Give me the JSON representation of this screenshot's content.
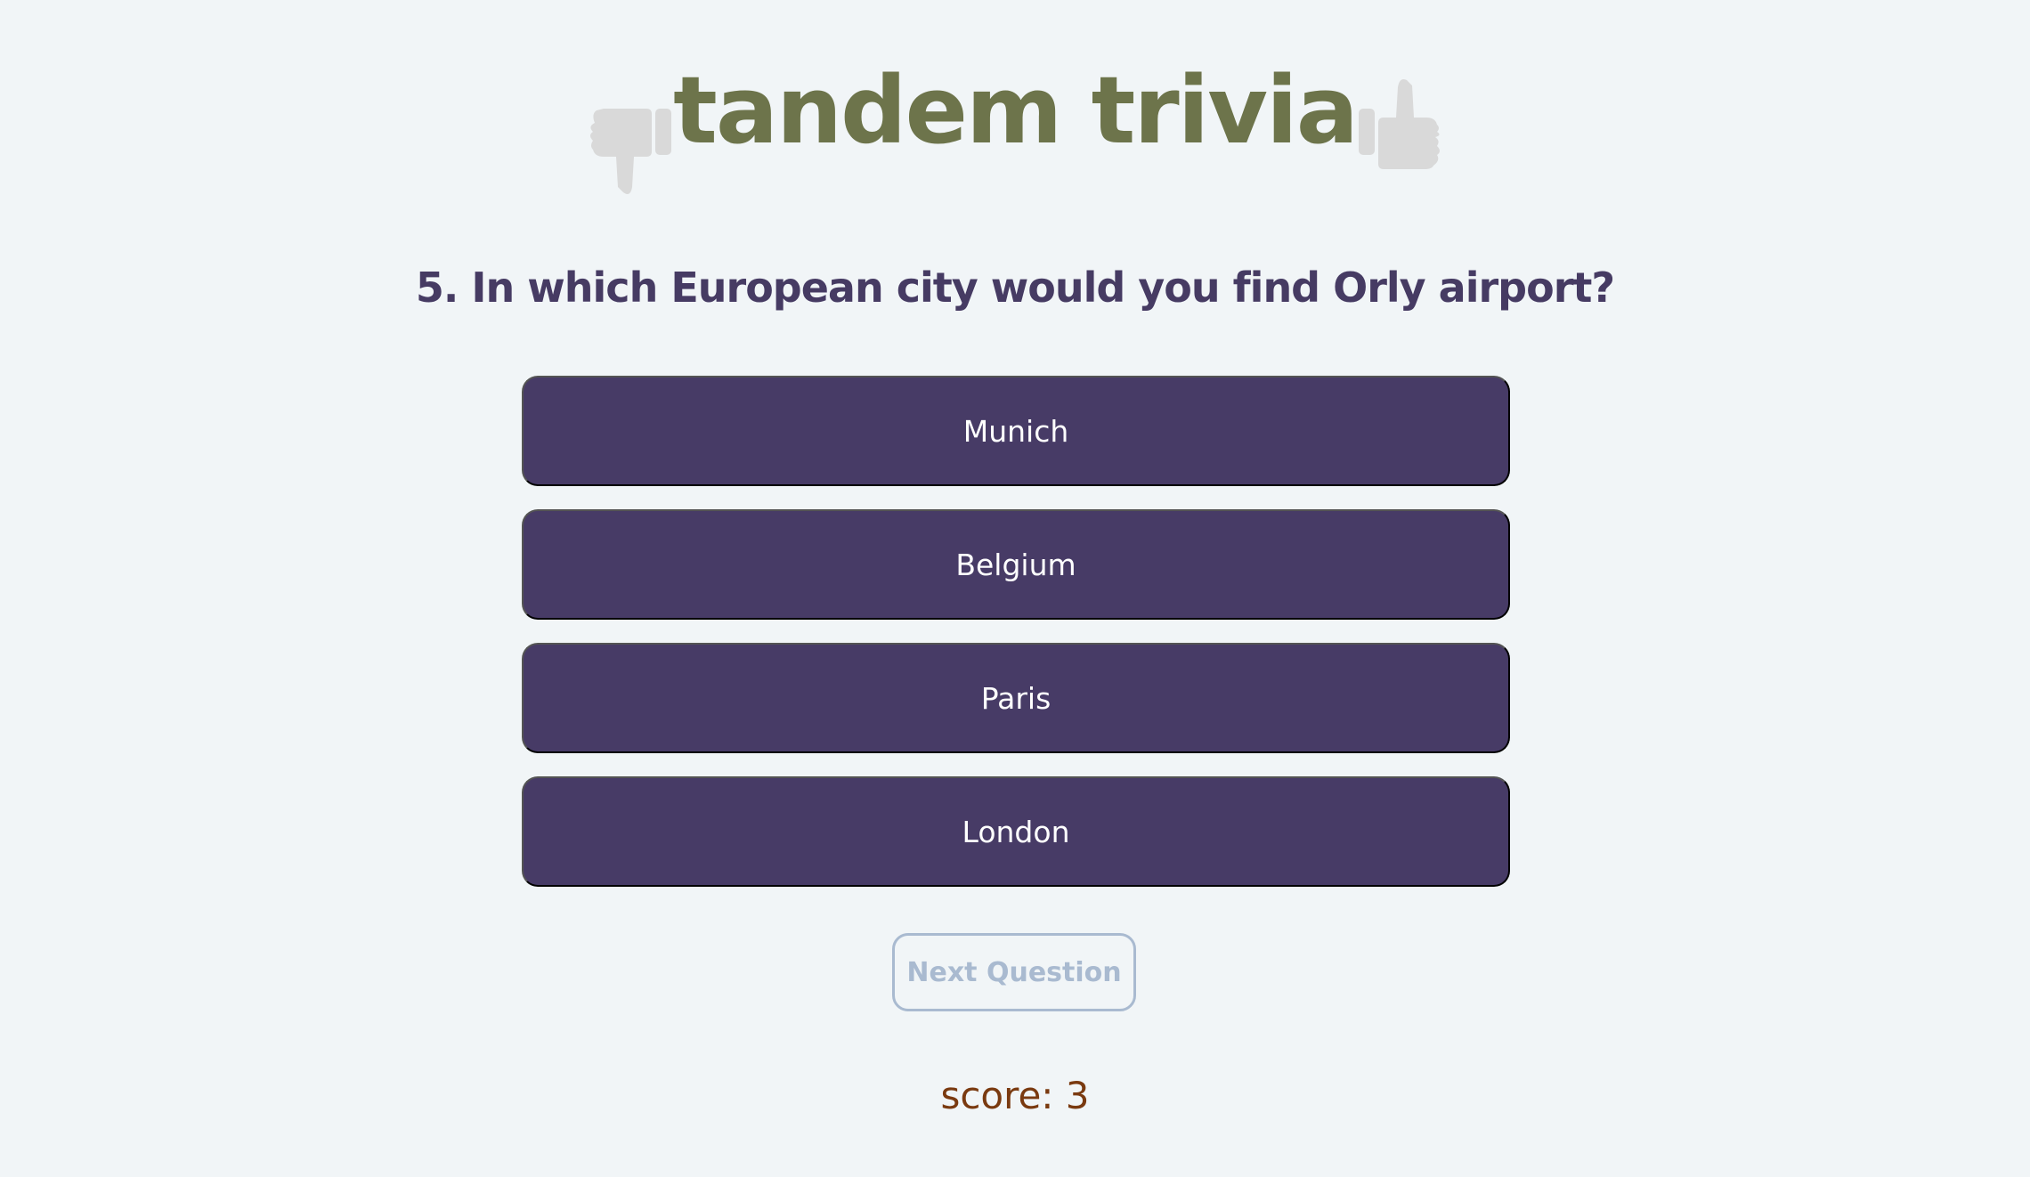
{
  "header": {
    "title": "tandem trivia",
    "left_icon": "thumbs-down-icon",
    "right_icon": "thumbs-up-icon"
  },
  "question": {
    "text": "5. In which European city would you find Orly airport?"
  },
  "answers": [
    {
      "label": "Munich"
    },
    {
      "label": "Belgium"
    },
    {
      "label": "Paris"
    },
    {
      "label": "London"
    }
  ],
  "next_button": {
    "label": "Next Question"
  },
  "score": {
    "text": "score: 3"
  },
  "colors": {
    "background": "#f1f5f7",
    "title": "#6d744b",
    "answer_bg": "#473b66",
    "next_border": "#a9bad0",
    "score": "#7a3a10",
    "thumb": "#d9d9d9"
  }
}
